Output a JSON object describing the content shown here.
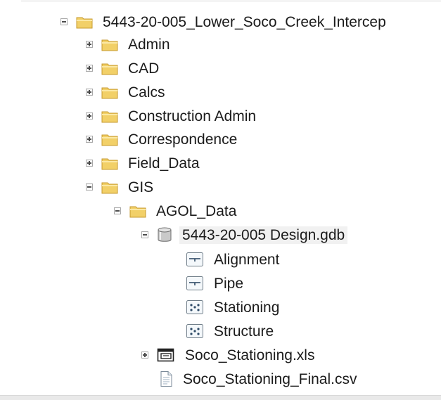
{
  "tree": {
    "root_label": "5443-20-005_Lower_Soco_Creek_Intercep",
    "folders": [
      "Admin",
      "CAD",
      "Calcs",
      "Construction Admin",
      "Correspondence",
      "Field_Data",
      "GIS"
    ],
    "gis_child": "AGOL_Data",
    "gdb_label": "5443-20-005 Design.gdb",
    "feature_classes": [
      "Alignment",
      "Pipe",
      "Stationing",
      "Structure"
    ],
    "xls_label": "Soco_Stationing.xls",
    "csv_label": "Soco_Stationing_Final.csv"
  },
  "icons": {
    "folder": "folder-icon",
    "geodatabase": "geodatabase-icon",
    "line_feature": "line-feature-class-icon",
    "point_feature": "point-feature-class-icon",
    "table": "table-icon",
    "text_file": "text-file-icon"
  },
  "colors": {
    "folder_fill": "#f2d068",
    "folder_edge": "#c79a2e",
    "text": "#1b1b1b",
    "selection": "#f1f1f1"
  }
}
